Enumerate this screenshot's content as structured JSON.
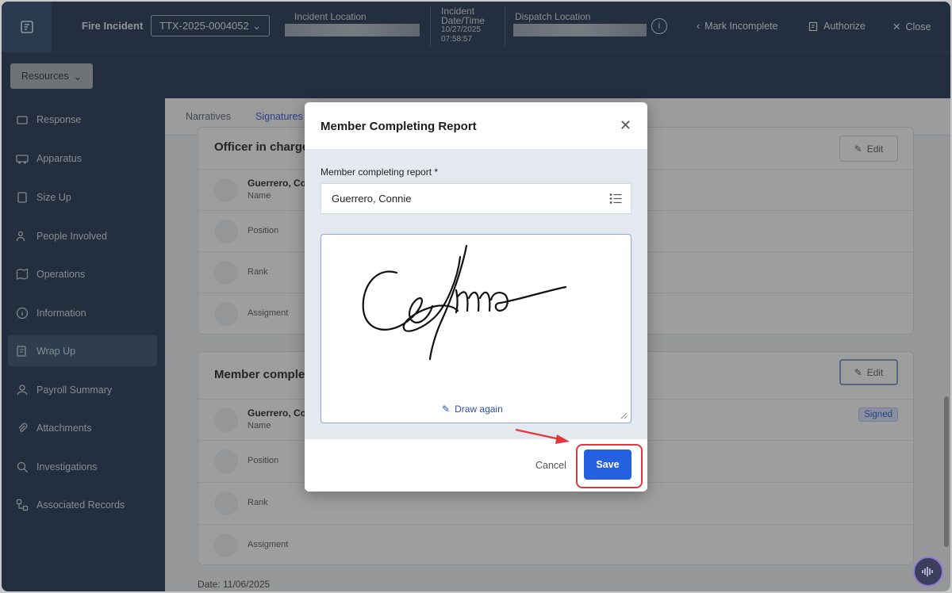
{
  "header": {
    "brand": "Fire Incident",
    "incident_number": "TTX-2025-0004052",
    "incident_location_label": "Incident Location",
    "incident_datetime_label": "Incident Date/Time",
    "incident_date_line1": "Incident",
    "incident_date_line2": "Date/Time",
    "incident_date": "10/27/2025",
    "incident_time": "07:58:57",
    "dispatch_location_label": "Dispatch Location",
    "mark_incomplete": "Mark Incomplete",
    "authorize": "Authorize",
    "close": "Close"
  },
  "subbar": {
    "resources": "Resources"
  },
  "sidebar": {
    "items": [
      {
        "label": "Response",
        "icon": "response-icon"
      },
      {
        "label": "Apparatus",
        "icon": "apparatus-icon"
      },
      {
        "label": "Size Up",
        "icon": "size-up-icon"
      },
      {
        "label": "People Involved",
        "icon": "people-icon"
      },
      {
        "label": "Operations",
        "icon": "map-icon"
      },
      {
        "label": "Information",
        "icon": "info-icon"
      },
      {
        "label": "Wrap Up",
        "icon": "wrap-up-icon"
      },
      {
        "label": "Payroll Summary",
        "icon": "payroll-icon"
      },
      {
        "label": "Attachments",
        "icon": "paperclip-icon"
      },
      {
        "label": "Investigations",
        "icon": "investigation-icon"
      },
      {
        "label": "Associated Records",
        "icon": "records-icon"
      }
    ],
    "active": "Wrap Up"
  },
  "tabs": [
    "Narratives",
    "Signatures"
  ],
  "cards": {
    "officer": {
      "title": "Officer in charge",
      "edit": "Edit",
      "name": "Guerrero, Co",
      "name_label": "Name",
      "position_label": "Position",
      "rank_label": "Rank",
      "assignment_label": "Assigment"
    },
    "member": {
      "title": "Member complet",
      "edit": "Edit",
      "name": "Guerrero, Co",
      "name_label": "Name",
      "signed": "Signed",
      "position_label": "Position",
      "rank_label": "Rank",
      "assignment_label": "Assigment"
    },
    "date": "Date: 11/06/2025"
  },
  "modal": {
    "title": "Member Completing Report",
    "field_label": "Member completing report",
    "required_mark": "*",
    "field_value": "Guerrero, Connie",
    "draw_again": "Draw again",
    "cancel": "Cancel",
    "save": "Save"
  },
  "colors": {
    "navy": "#1f3450",
    "primary": "#2461e0",
    "highlight": "#e0383e"
  }
}
